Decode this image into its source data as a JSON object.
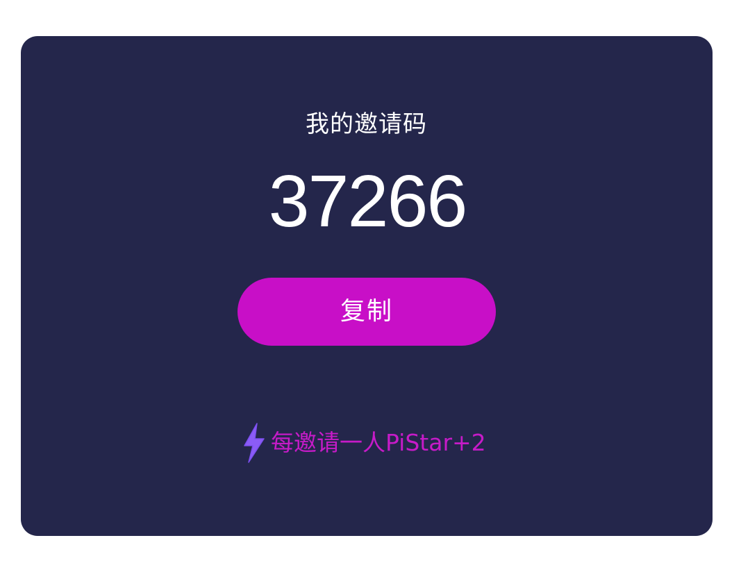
{
  "invite": {
    "title": "我的邀请码",
    "code": "37266",
    "copy_label": "复制",
    "tip_text": "每邀请一人PiStar+2",
    "tip_icon": "lightning-bolt-icon"
  },
  "colors": {
    "card_background": "#24264b",
    "button_background": "#c80fc7",
    "tip_text": "#c61bc8",
    "bolt_icon": "#8b5cf6"
  }
}
